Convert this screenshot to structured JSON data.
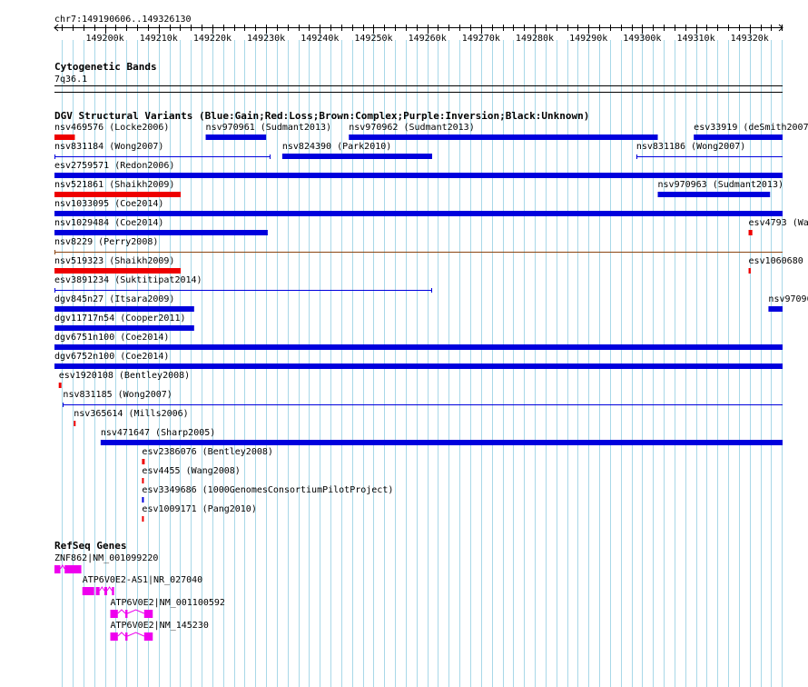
{
  "region": {
    "label": "chr7:149190606..149326130",
    "start": 149190606,
    "end": 149326130,
    "ticks": [
      {
        "pos": 149200000,
        "label": "149200k"
      },
      {
        "pos": 149210000,
        "label": "149210k"
      },
      {
        "pos": 149220000,
        "label": "149220k"
      },
      {
        "pos": 149230000,
        "label": "149230k"
      },
      {
        "pos": 149240000,
        "label": "149240k"
      },
      {
        "pos": 149250000,
        "label": "149250k"
      },
      {
        "pos": 149260000,
        "label": "149260k"
      },
      {
        "pos": 149270000,
        "label": "149270k"
      },
      {
        "pos": 149280000,
        "label": "149280k"
      },
      {
        "pos": 149290000,
        "label": "149290k"
      },
      {
        "pos": 149300000,
        "label": "149300k"
      },
      {
        "pos": 149310000,
        "label": "149310k"
      },
      {
        "pos": 149320000,
        "label": "149320k"
      }
    ]
  },
  "colors": {
    "gain": "#0000dd",
    "loss": "#ee0000",
    "complex": "#8b4513",
    "gene": "#ee00ee",
    "grid": "#a8d8e8"
  },
  "tracks": {
    "cytoband": {
      "title": "Cytogenetic Bands",
      "band": "7q36.1"
    },
    "dgv": {
      "title": "DGV Structural Variants (Blue:Gain;Red:Loss;Brown:Complex;Purple:Inversion;Black:Unknown)",
      "features": [
        {
          "name": "nsv469576 (Locke2006)",
          "start": 149190606,
          "end": 149194400,
          "type": "loss",
          "style": "bar"
        },
        {
          "name": "nsv970961 (Sudmant2013)",
          "start": 149218750,
          "end": 149230000,
          "type": "gain",
          "style": "bar"
        },
        {
          "name": "nsv970962 (Sudmant2013)",
          "start": 149245400,
          "end": 149302900,
          "type": "gain",
          "style": "bar"
        },
        {
          "name": "esv33919 (deSmith2007)",
          "start": 149309600,
          "end": 149326130,
          "type": "gain",
          "style": "bar"
        },
        {
          "name": "nsv831184 (Wong2007)",
          "start": 149190606,
          "end": 149230800,
          "type": "gain",
          "style": "line"
        },
        {
          "name": "nsv824390 (Park2010)",
          "start": 149233000,
          "end": 149260900,
          "type": "gain",
          "style": "bar"
        },
        {
          "name": "nsv831186 (Wong2007)",
          "start": 149298900,
          "end": 149326130,
          "type": "gain",
          "style": "line"
        },
        {
          "name": "esv2759571 (Redon2006)",
          "start": 149190606,
          "end": 149326130,
          "type": "gain",
          "style": "bar"
        },
        {
          "name": "nsv521861 (Shaikh2009)",
          "start": 149190606,
          "end": 149214100,
          "type": "loss",
          "style": "bar"
        },
        {
          "name": "nsv970963 (Sudmant2013)",
          "start": 149302900,
          "end": 149323800,
          "type": "gain",
          "style": "bar"
        },
        {
          "name": "nsv1033095 (Coe2014)",
          "start": 149190606,
          "end": 149326130,
          "type": "gain",
          "style": "bar"
        },
        {
          "name": "nsv1029484 (Coe2014)",
          "start": 149190606,
          "end": 149230300,
          "type": "gain",
          "style": "bar"
        },
        {
          "name": "esv4793 (Wan",
          "start": 149319800,
          "end": 149320500,
          "type": "loss",
          "style": "bar"
        },
        {
          "name": "nsv8229 (Perry2008)",
          "start": 149190606,
          "end": 149326130,
          "type": "complex",
          "style": "line"
        },
        {
          "name": "nsv519323 (Shaikh2009)",
          "start": 149190606,
          "end": 149214100,
          "type": "loss",
          "style": "bar"
        },
        {
          "name": "esv1060680",
          "start": 149319800,
          "end": 149320200,
          "type": "loss",
          "style": "bar"
        },
        {
          "name": "esv3891234 (Suktitipat2014)",
          "start": 149190606,
          "end": 149260900,
          "type": "gain",
          "style": "line"
        },
        {
          "name": "dgv845n27 (Itsara2009)",
          "start": 149190606,
          "end": 149216600,
          "type": "gain",
          "style": "bar"
        },
        {
          "name": "nsv97096",
          "start": 149323500,
          "end": 149326130,
          "type": "gain",
          "style": "bar"
        },
        {
          "name": "dgv11717n54 (Cooper2011)",
          "start": 149190606,
          "end": 149216600,
          "type": "gain",
          "style": "bar"
        },
        {
          "name": "dgv6751n100 (Coe2014)",
          "start": 149190606,
          "end": 149326130,
          "type": "gain",
          "style": "bar"
        },
        {
          "name": "dgv6752n100 (Coe2014)",
          "start": 149190606,
          "end": 149326130,
          "type": "gain",
          "style": "bar"
        },
        {
          "name": "esv1920108 (Bentley2008)",
          "start": 149191400,
          "end": 149191900,
          "type": "loss",
          "style": "bar"
        },
        {
          "name": "nsv831185 (Wong2007)",
          "start": 149192200,
          "end": 149326130,
          "type": "gain",
          "style": "line"
        },
        {
          "name": "nsv365614 (Mills2006)",
          "start": 149194200,
          "end": 149194500,
          "type": "loss",
          "style": "bar"
        },
        {
          "name": "nsv471647 (Sharp2005)",
          "start": 149199200,
          "end": 149326130,
          "type": "gain",
          "style": "bar"
        },
        {
          "name": "esv2386076 (Bentley2008)",
          "start": 149206900,
          "end": 149207400,
          "type": "loss",
          "style": "bar"
        },
        {
          "name": "esv4455 (Wang2008)",
          "start": 149206900,
          "end": 149207200,
          "type": "loss",
          "style": "bar"
        },
        {
          "name": "esv3349686 (1000GenomesConsortiumPilotProject)",
          "start": 149206900,
          "end": 149207200,
          "type": "gain",
          "style": "bar"
        },
        {
          "name": "esv1009171 (Pang2010)",
          "start": 149206900,
          "end": 149207200,
          "type": "loss",
          "style": "bar"
        }
      ]
    },
    "refseq": {
      "title": "RefSeq Genes",
      "genes": [
        {
          "name": "ZNF862|NM_001099220",
          "exons": [
            [
              149190606,
              149191700
            ],
            [
              149192500,
              149195600
            ]
          ],
          "introns": [
            [
              149191700,
              149192500
            ]
          ]
        },
        {
          "name": "ATP6V0E2-AS1|NR_027040",
          "exons": [
            [
              149195800,
              149198000
            ],
            [
              149198300,
              149199000
            ],
            [
              149199900,
              149200400
            ],
            [
              149201300,
              149201700
            ]
          ],
          "introns": [
            [
              149199000,
              149199900
            ],
            [
              149200400,
              149201300
            ]
          ]
        },
        {
          "name": "ATP6V0E2|NM_001100592",
          "exons": [
            [
              149201000,
              149202400
            ],
            [
              149203800,
              149204200
            ],
            [
              149207300,
              149208900
            ]
          ],
          "introns": [
            [
              149202400,
              149203800
            ],
            [
              149204200,
              149207300
            ]
          ]
        },
        {
          "name": "ATP6V0E2|NM_145230",
          "exons": [
            [
              149201000,
              149202400
            ],
            [
              149203800,
              149204200
            ],
            [
              149207300,
              149208900
            ]
          ],
          "introns": [
            [
              149202400,
              149203800
            ],
            [
              149204200,
              149207300
            ]
          ]
        }
      ]
    }
  }
}
